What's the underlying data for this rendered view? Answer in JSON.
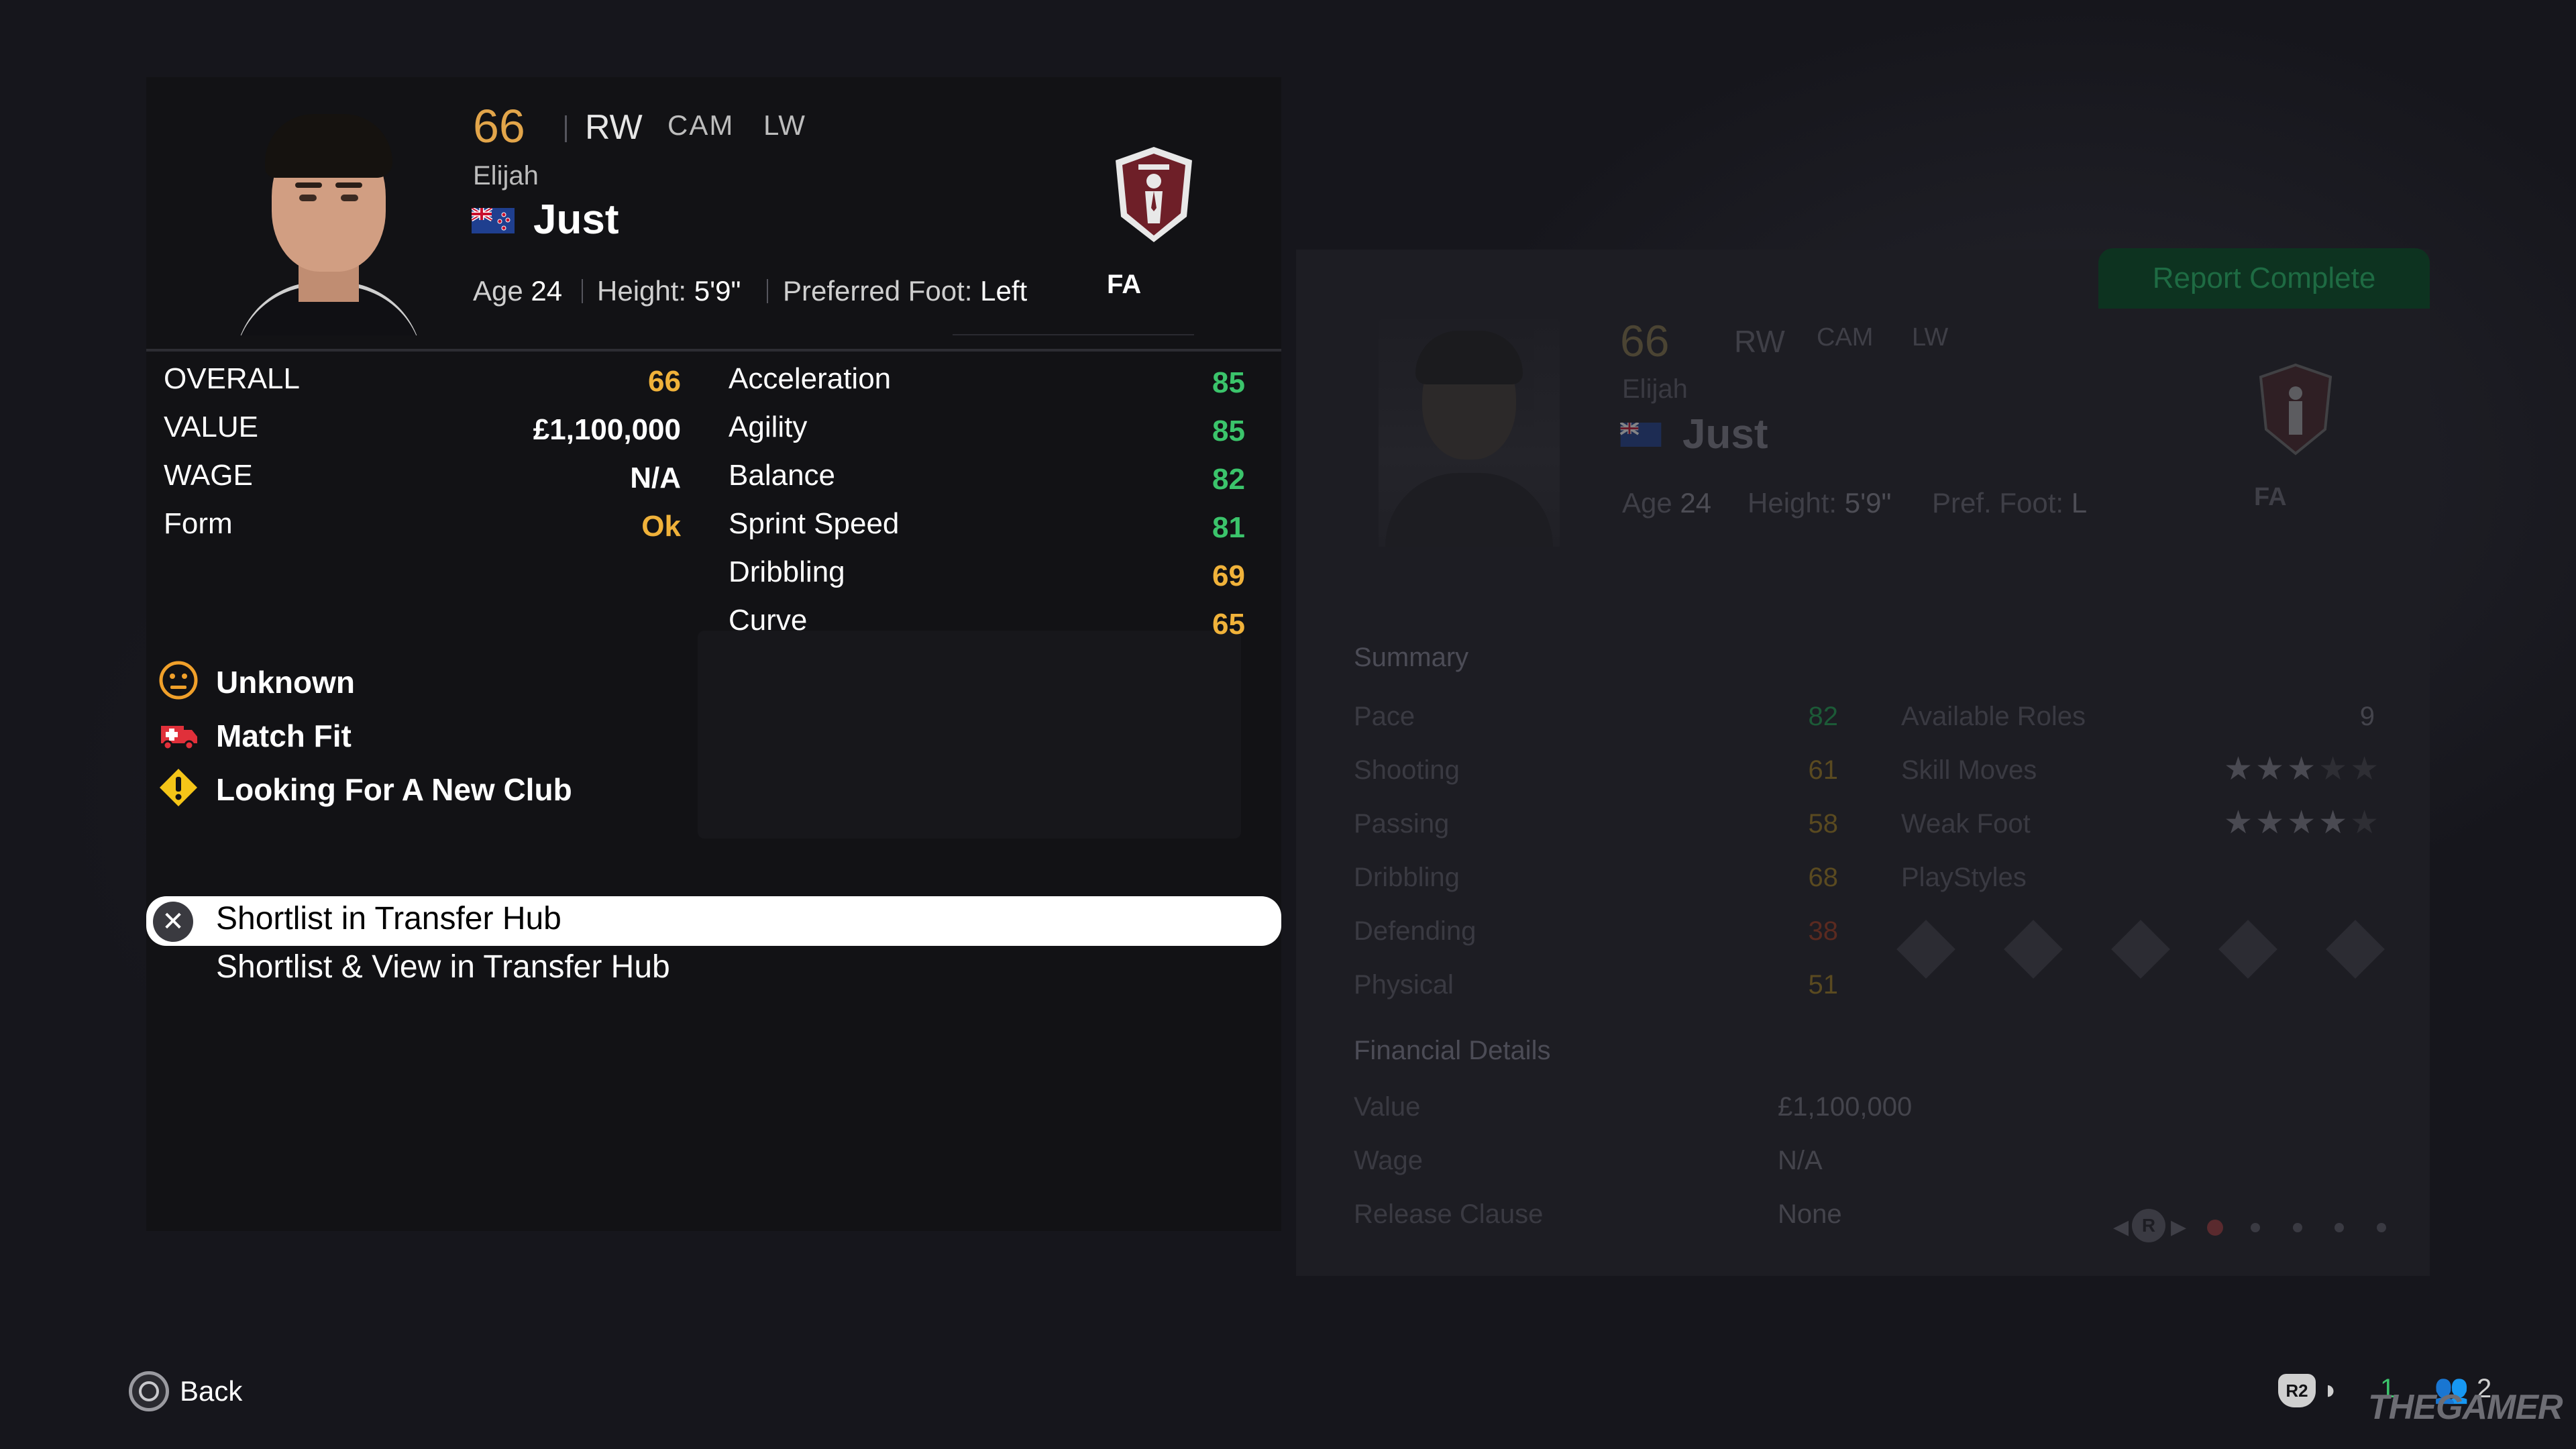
{
  "player": {
    "rating": "66",
    "main_position": "RW",
    "alt_positions": [
      "CAM",
      "LW"
    ],
    "first_name": "Elijah",
    "last_name": "Just",
    "age_label": "Age",
    "age": "24",
    "height_label": "Height:",
    "height": "5'9\"",
    "foot_label": "Preferred Foot:",
    "foot": "Left",
    "club": "FA"
  },
  "left_stats": [
    {
      "label": "OVERALL",
      "value": "66",
      "color": "#f0b23a"
    },
    {
      "label": "VALUE",
      "value": "£1,100,000",
      "color": "#ffffff"
    },
    {
      "label": "WAGE",
      "value": "N/A",
      "color": "#ffffff"
    },
    {
      "label": "Form",
      "value": "Ok",
      "color": "#f0b23a"
    }
  ],
  "right_stats": [
    {
      "label": "Acceleration",
      "value": "85",
      "color": "#3bc46b"
    },
    {
      "label": "Agility",
      "value": "85",
      "color": "#3bc46b"
    },
    {
      "label": "Balance",
      "value": "82",
      "color": "#3bc46b"
    },
    {
      "label": "Sprint Speed",
      "value": "81",
      "color": "#3bc46b"
    },
    {
      "label": "Dribbling",
      "value": "69",
      "color": "#f0b23a"
    },
    {
      "label": "Curve",
      "value": "65",
      "color": "#f0b23a"
    }
  ],
  "status": [
    {
      "icon": "neutral-face-icon",
      "label": "Unknown"
    },
    {
      "icon": "ambulance-icon",
      "label": "Match Fit"
    },
    {
      "icon": "warning-icon",
      "label": "Looking For A New Club"
    }
  ],
  "options": [
    {
      "label": "Shortlist in Transfer Hub",
      "selected": true
    },
    {
      "label": "Shortlist & View in Transfer Hub",
      "selected": false
    }
  ],
  "report": {
    "button": "Report Complete",
    "rating": "66",
    "main_position": "RW",
    "alt_positions": [
      "CAM",
      "LW"
    ],
    "first_name": "Elijah",
    "last_name": "Just",
    "age_label": "Age",
    "age": "24",
    "height_label": "Height:",
    "height": "5'9\"",
    "foot_label": "Pref. Foot:",
    "foot": "L",
    "club": "FA",
    "summary_title": "Summary",
    "summary": [
      {
        "label": "Pace",
        "value": "82",
        "color": "#1c5a37"
      },
      {
        "label": "Shooting",
        "value": "61",
        "color": "#5a4a20"
      },
      {
        "label": "Passing",
        "value": "58",
        "color": "#5a4a20"
      },
      {
        "label": "Dribbling",
        "value": "68",
        "color": "#5a4a20"
      },
      {
        "label": "Defending",
        "value": "38",
        "color": "#5a2a20"
      },
      {
        "label": "Physical",
        "value": "51",
        "color": "#5a4a20"
      }
    ],
    "available_roles_label": "Available Roles",
    "available_roles": "9",
    "skill_moves_label": "Skill Moves",
    "skill_moves": 3,
    "weak_foot_label": "Weak Foot",
    "weak_foot": 4,
    "playstyles_label": "PlayStyles",
    "financial_title": "Financial Details",
    "financial": [
      {
        "label": "Value",
        "value": "£1,100,000"
      },
      {
        "label": "Wage",
        "value": "N/A"
      },
      {
        "label": "Release Clause",
        "value": "None"
      }
    ],
    "pager_button": "R"
  },
  "footer": {
    "back": "Back",
    "r2_label": "R2",
    "count1": "1",
    "count2": "2",
    "watermark": "THEGAMER"
  }
}
